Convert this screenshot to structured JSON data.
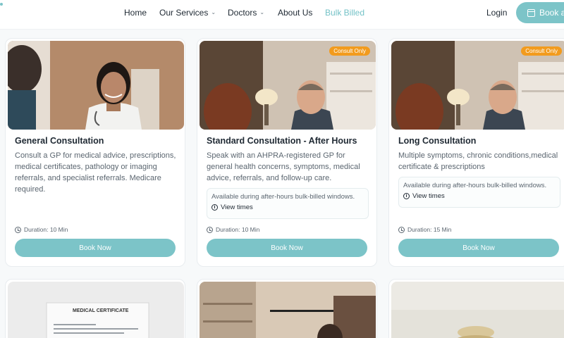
{
  "nav": {
    "items": [
      {
        "label": "Home",
        "dropdown": false,
        "active": false
      },
      {
        "label": "Our Services",
        "dropdown": true,
        "active": false
      },
      {
        "label": "Doctors",
        "dropdown": true,
        "active": false
      },
      {
        "label": "About Us",
        "dropdown": false,
        "active": false
      },
      {
        "label": "Bulk Billed",
        "dropdown": false,
        "active": true
      }
    ],
    "login_label": "Login",
    "book_label": "Book an"
  },
  "cards": [
    {
      "title": "General Consultation",
      "description": "Consult a GP for medical advice, prescriptions, medical certificates, pathology or imaging referrals, and specialist referrals. Medicare required.",
      "badge": "",
      "availability": "",
      "view_times": "",
      "duration": "Duration: 10 Min",
      "button": "Book Now"
    },
    {
      "title": "Standard Consultation - After Hours",
      "description": "Speak with an AHPRA-registered GP for general health concerns, symptoms, medical advice, referrals, and follow-up care.",
      "badge": "Consult Only",
      "availability": "Available during after-hours bulk-billed windows.",
      "view_times": "View times",
      "duration": "Duration: 10 Min",
      "button": "Book Now"
    },
    {
      "title": "Long Consultation",
      "description": "Multiple symptoms, chronic conditions,medical certificate & prescriptions",
      "badge": "Consult Only",
      "availability": "Available during after-hours bulk-billed windows.",
      "view_times": "View times",
      "duration": "Duration: 15 Min",
      "button": "Book Now"
    }
  ],
  "second_row": {
    "certificate_heading": "MEDICAL CERTIFICATE"
  },
  "colors": {
    "accent": "#7cc4c8",
    "badge": "#f29b1d",
    "active_nav": "#74c2c7"
  }
}
